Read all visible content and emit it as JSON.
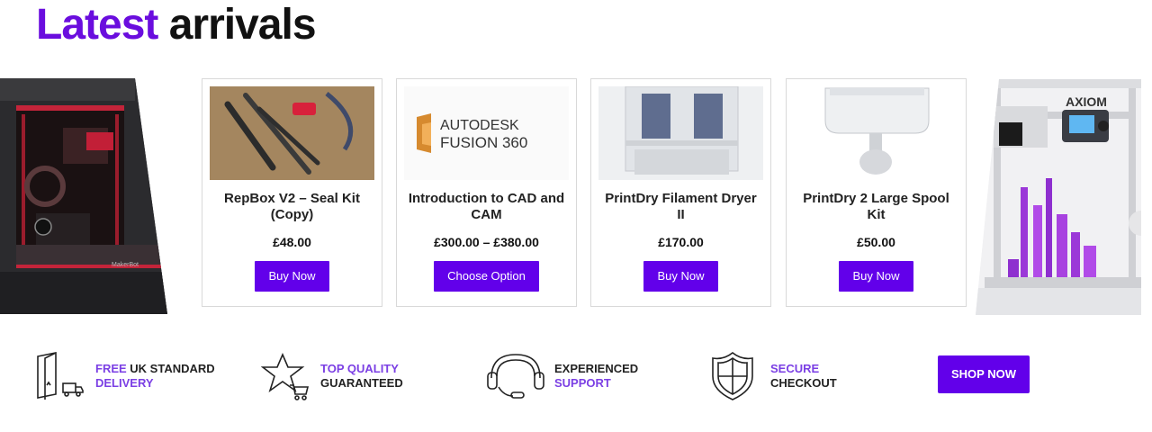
{
  "section": {
    "title_accent": "Latest",
    "title_rest": "arrivals"
  },
  "banners": {
    "left_brand": "MakerBot",
    "right_brand": "AXIOM"
  },
  "products": [
    {
      "title": "RepBox V2 – Seal Kit (Copy)",
      "price": "£48.00",
      "button": "Buy Now"
    },
    {
      "title": "Introduction to CAD and CAM",
      "price": "£300.00 – £380.00",
      "button": "Choose Option",
      "logo_line1": "AUTODESK",
      "logo_line2": "FUSION 360"
    },
    {
      "title": "PrintDry Filament Dryer II",
      "price": "£170.00",
      "button": "Buy Now"
    },
    {
      "title": "PrintDry 2 Large Spool Kit",
      "price": "£50.00",
      "button": "Buy Now"
    }
  ],
  "features": [
    {
      "icon": "delivery-box-icon",
      "line1_hl": "FREE",
      "line1_rest": " UK STANDARD",
      "line2_hl": "DELIVERY",
      "line2_rest": ""
    },
    {
      "icon": "star-cart-icon",
      "line1_hl": "TOP QUALITY",
      "line1_rest": "",
      "line2_hl": "",
      "line2_rest": "GUARANTEED"
    },
    {
      "icon": "headset-icon",
      "line1_hl": "",
      "line1_rest": "EXPERIENCED",
      "line2_hl": "SUPPORT",
      "line2_rest": ""
    },
    {
      "icon": "shield-icon",
      "line1_hl": "SECURE",
      "line1_rest": "",
      "line2_hl": "",
      "line2_rest": "CHECKOUT"
    }
  ],
  "cta": {
    "label": "SHOP NOW"
  },
  "colors": {
    "accent": "#6a0dde",
    "button": "#6200ea",
    "highlight": "#7b3fe4"
  }
}
